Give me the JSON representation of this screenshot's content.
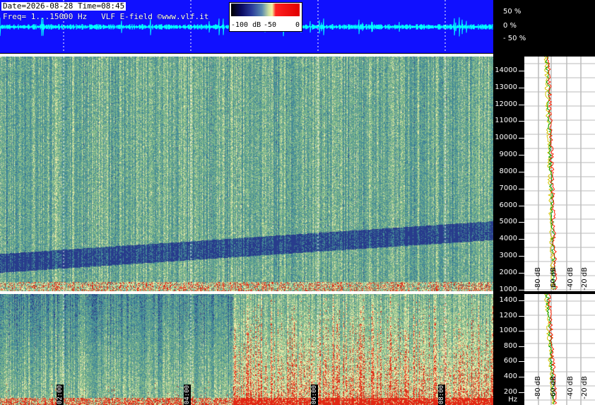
{
  "header": {
    "date_time": "Date=2026-08-28 Time=08:45",
    "freq_line": "Freq= 1...15000 Hz   VLF E-field ©www.vlf.it"
  },
  "colorbar": {
    "labels": [
      "-100 dB",
      "-50",
      "0"
    ]
  },
  "waveform": {
    "percent_labels": [
      "50 %",
      "0 %",
      "- 50 %"
    ]
  },
  "top_freq_axis": [
    "14000",
    "13000",
    "12000",
    "11000",
    "10000",
    "9000",
    "8000",
    "7000",
    "6000",
    "5000",
    "4000",
    "3000",
    "2000",
    "1000"
  ],
  "bottom_freq_axis": [
    "1400",
    "1200",
    "1000",
    "800",
    "600",
    "400",
    "200 Hz"
  ],
  "time_markers": [
    "02:00",
    "04:00",
    "06:00",
    "08:00"
  ],
  "profile_db_labels": [
    "-80 dB",
    "-60 dB",
    "-40 dB",
    "-20 dB"
  ],
  "colors": {
    "waveform_bg": "#1010ff",
    "trace": "#00ffff",
    "hot": "#ff2000"
  }
}
